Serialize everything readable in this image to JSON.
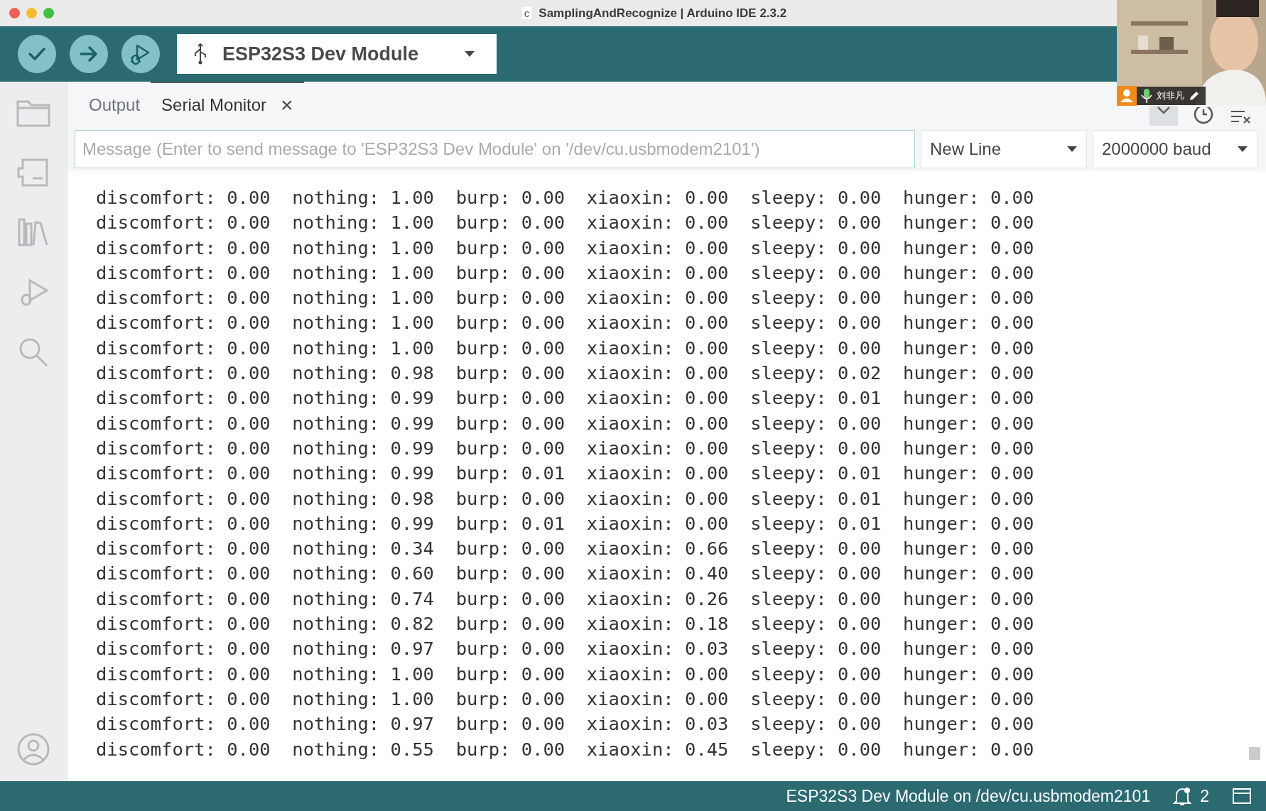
{
  "window": {
    "title": "SamplingAndRecognize | Arduino IDE 2.3.2",
    "file_icon": "c"
  },
  "toolbar": {
    "board": "ESP32S3 Dev Module"
  },
  "tabs": [
    {
      "label": "Output",
      "selected": false,
      "closable": false
    },
    {
      "label": "Serial Monitor",
      "selected": true,
      "closable": true
    }
  ],
  "close_glyph": "×",
  "message": {
    "placeholder": "Message (Enter to send message to 'ESP32S3 Dev Module' on '/dev/cu.usbmodem2101')"
  },
  "line_ending": "New Line",
  "baud": "2000000 baud",
  "lines": [
    "discomfort: 0.00  nothing: 1.00  burp: 0.00  xiaoxin: 0.00  sleepy: 0.00  hunger: 0.00",
    "discomfort: 0.00  nothing: 1.00  burp: 0.00  xiaoxin: 0.00  sleepy: 0.00  hunger: 0.00",
    "discomfort: 0.00  nothing: 1.00  burp: 0.00  xiaoxin: 0.00  sleepy: 0.00  hunger: 0.00",
    "discomfort: 0.00  nothing: 1.00  burp: 0.00  xiaoxin: 0.00  sleepy: 0.00  hunger: 0.00",
    "discomfort: 0.00  nothing: 1.00  burp: 0.00  xiaoxin: 0.00  sleepy: 0.00  hunger: 0.00",
    "discomfort: 0.00  nothing: 1.00  burp: 0.00  xiaoxin: 0.00  sleepy: 0.00  hunger: 0.00",
    "discomfort: 0.00  nothing: 1.00  burp: 0.00  xiaoxin: 0.00  sleepy: 0.00  hunger: 0.00",
    "discomfort: 0.00  nothing: 0.98  burp: 0.00  xiaoxin: 0.00  sleepy: 0.02  hunger: 0.00",
    "discomfort: 0.00  nothing: 0.99  burp: 0.00  xiaoxin: 0.00  sleepy: 0.01  hunger: 0.00",
    "discomfort: 0.00  nothing: 0.99  burp: 0.00  xiaoxin: 0.00  sleepy: 0.00  hunger: 0.00",
    "discomfort: 0.00  nothing: 0.99  burp: 0.00  xiaoxin: 0.00  sleepy: 0.00  hunger: 0.00",
    "discomfort: 0.00  nothing: 0.99  burp: 0.01  xiaoxin: 0.00  sleepy: 0.01  hunger: 0.00",
    "discomfort: 0.00  nothing: 0.98  burp: 0.00  xiaoxin: 0.00  sleepy: 0.01  hunger: 0.00",
    "discomfort: 0.00  nothing: 0.99  burp: 0.01  xiaoxin: 0.00  sleepy: 0.01  hunger: 0.00",
    "discomfort: 0.00  nothing: 0.34  burp: 0.00  xiaoxin: 0.66  sleepy: 0.00  hunger: 0.00",
    "discomfort: 0.00  nothing: 0.60  burp: 0.00  xiaoxin: 0.40  sleepy: 0.00  hunger: 0.00",
    "discomfort: 0.00  nothing: 0.74  burp: 0.00  xiaoxin: 0.26  sleepy: 0.00  hunger: 0.00",
    "discomfort: 0.00  nothing: 0.82  burp: 0.00  xiaoxin: 0.18  sleepy: 0.00  hunger: 0.00",
    "discomfort: 0.00  nothing: 0.97  burp: 0.00  xiaoxin: 0.03  sleepy: 0.00  hunger: 0.00",
    "discomfort: 0.00  nothing: 1.00  burp: 0.00  xiaoxin: 0.00  sleepy: 0.00  hunger: 0.00",
    "discomfort: 0.00  nothing: 1.00  burp: 0.00  xiaoxin: 0.00  sleepy: 0.00  hunger: 0.00",
    "discomfort: 0.00  nothing: 0.97  burp: 0.00  xiaoxin: 0.03  sleepy: 0.00  hunger: 0.00",
    "discomfort: 0.00  nothing: 0.55  burp: 0.00  xiaoxin: 0.45  sleepy: 0.00  hunger: 0.00"
  ],
  "status_bar": {
    "board_port": "ESP32S3 Dev Module on /dev/cu.usbmodem2101",
    "notifications": "2"
  },
  "video_overlay": {
    "name": "刘非凡"
  }
}
